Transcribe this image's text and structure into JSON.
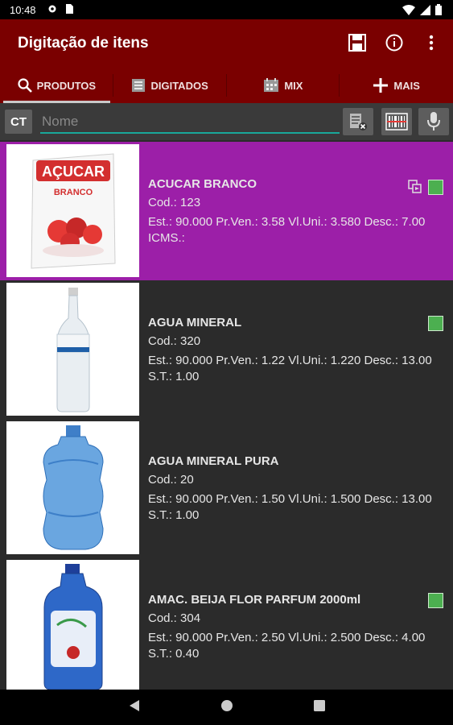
{
  "status_bar": {
    "time": "10:48"
  },
  "app_bar": {
    "title": "Digitação de itens"
  },
  "tabs": [
    {
      "label": "PRODUTOS",
      "icon": "search-icon"
    },
    {
      "label": "DIGITADOS",
      "icon": "list-icon"
    },
    {
      "label": "MIX",
      "icon": "calendar-icon"
    },
    {
      "label": "MAIS",
      "icon": "plus-icon"
    }
  ],
  "search": {
    "prefix": "CT",
    "placeholder": "Nome",
    "value": ""
  },
  "products": [
    {
      "name": "ACUCAR BRANCO",
      "code": "Cod.: 123",
      "details": "Est.: 90.000 Pr.Ven.: 3.58 Vl.Uni.: 3.580 Desc.: 7.00 ICMS.:",
      "package_text": "AÇUCAR",
      "package_subtext": "BRANCO"
    },
    {
      "name": "AGUA MINERAL",
      "code": "Cod.: 320",
      "details": "Est.: 90.000 Pr.Ven.: 1.22 Vl.Uni.: 1.220 Desc.: 13.00 S.T.: 1.00"
    },
    {
      "name": "AGUA MINERAL PURA",
      "code": "Cod.: 20",
      "details": "Est.: 90.000 Pr.Ven.: 1.50 Vl.Uni.: 1.500 Desc.: 13.00 S.T.: 1.00"
    },
    {
      "name": "AMAC. BEIJA FLOR PARFUM 2000ml",
      "code": "Cod.: 304",
      "details": "Est.: 90.000 Pr.Ven.: 2.50 Vl.Uni.: 2.500 Desc.: 4.00 S.T.: 0.40"
    }
  ],
  "colors": {
    "primary": "#7a0000",
    "selected_row": "#9c1fa8",
    "accent": "#19a89a",
    "status_ok": "#4caf50"
  }
}
